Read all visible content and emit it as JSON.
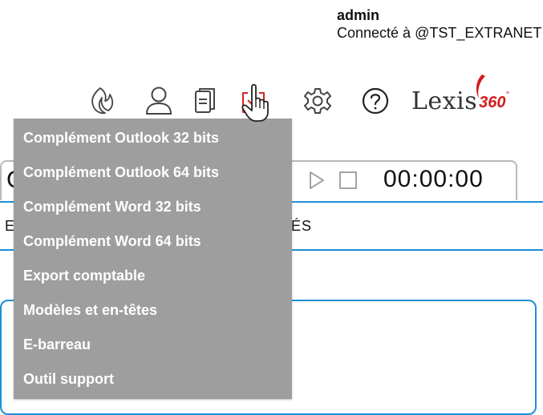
{
  "user": {
    "name": "admin",
    "connection": "Connecté à @TST_EXTRANET"
  },
  "toolbar": {
    "icons": [
      "flame-icon",
      "user-icon",
      "documents-icon",
      "download-icon",
      "gear-icon",
      "help-icon"
    ],
    "brand_text": "Lexis",
    "brand_number": "360",
    "brand_suffix": "°"
  },
  "timer": {
    "leading_letter": "C",
    "value": "00:00:00"
  },
  "tabs": {
    "left_label": "E",
    "right_label": "TÉS"
  },
  "menu": {
    "items": [
      "Complément Outlook 32 bits",
      "Complément Outlook 64 bits",
      "Complément Word 32 bits",
      "Complément Word 64 bits",
      "Export comptable",
      "Modèles et en-têtes",
      "E-barreau",
      "Outil support"
    ]
  },
  "colors": {
    "accent_blue": "#1d8fd6",
    "menu_bg": "#9e9e9e",
    "brand_red": "#d21c1c"
  }
}
